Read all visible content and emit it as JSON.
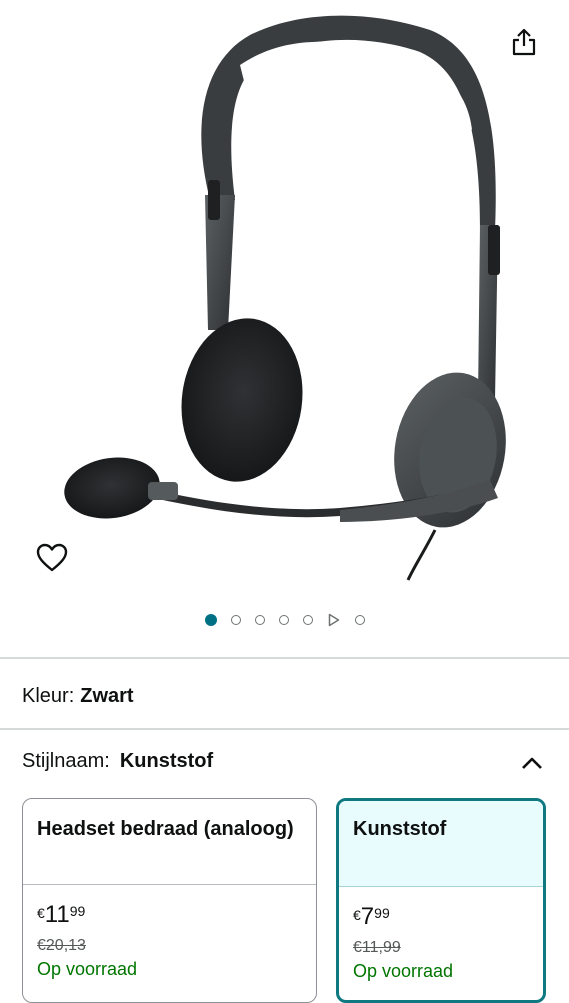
{
  "gallery": {
    "image_alt": "Headset bedraad",
    "share_icon": "share-icon",
    "wishlist_icon": "heart-icon",
    "dots_total": 6,
    "active_index": 0,
    "has_video": true
  },
  "variation": {
    "color_label": "Kleur:",
    "color_value": "Zwart",
    "style_label": "Stijlnaam:",
    "style_value": "Kunststof"
  },
  "options": [
    {
      "name": "Headset bedraad (analoog)",
      "price_currency": "€",
      "price_whole": "11",
      "price_fraction": "99",
      "old_price": "€20,13",
      "availability": "Op voorraad",
      "selected": false
    },
    {
      "name": "Kunststof",
      "price_currency": "€",
      "price_whole": "7",
      "price_fraction": "99",
      "old_price": "€11,99",
      "availability": "Op voorraad",
      "selected": true
    }
  ],
  "colors": {
    "accent": "#007185",
    "in_stock": "#007600",
    "selected_border": "#0f7981",
    "selected_bg": "#e8fbfd"
  }
}
